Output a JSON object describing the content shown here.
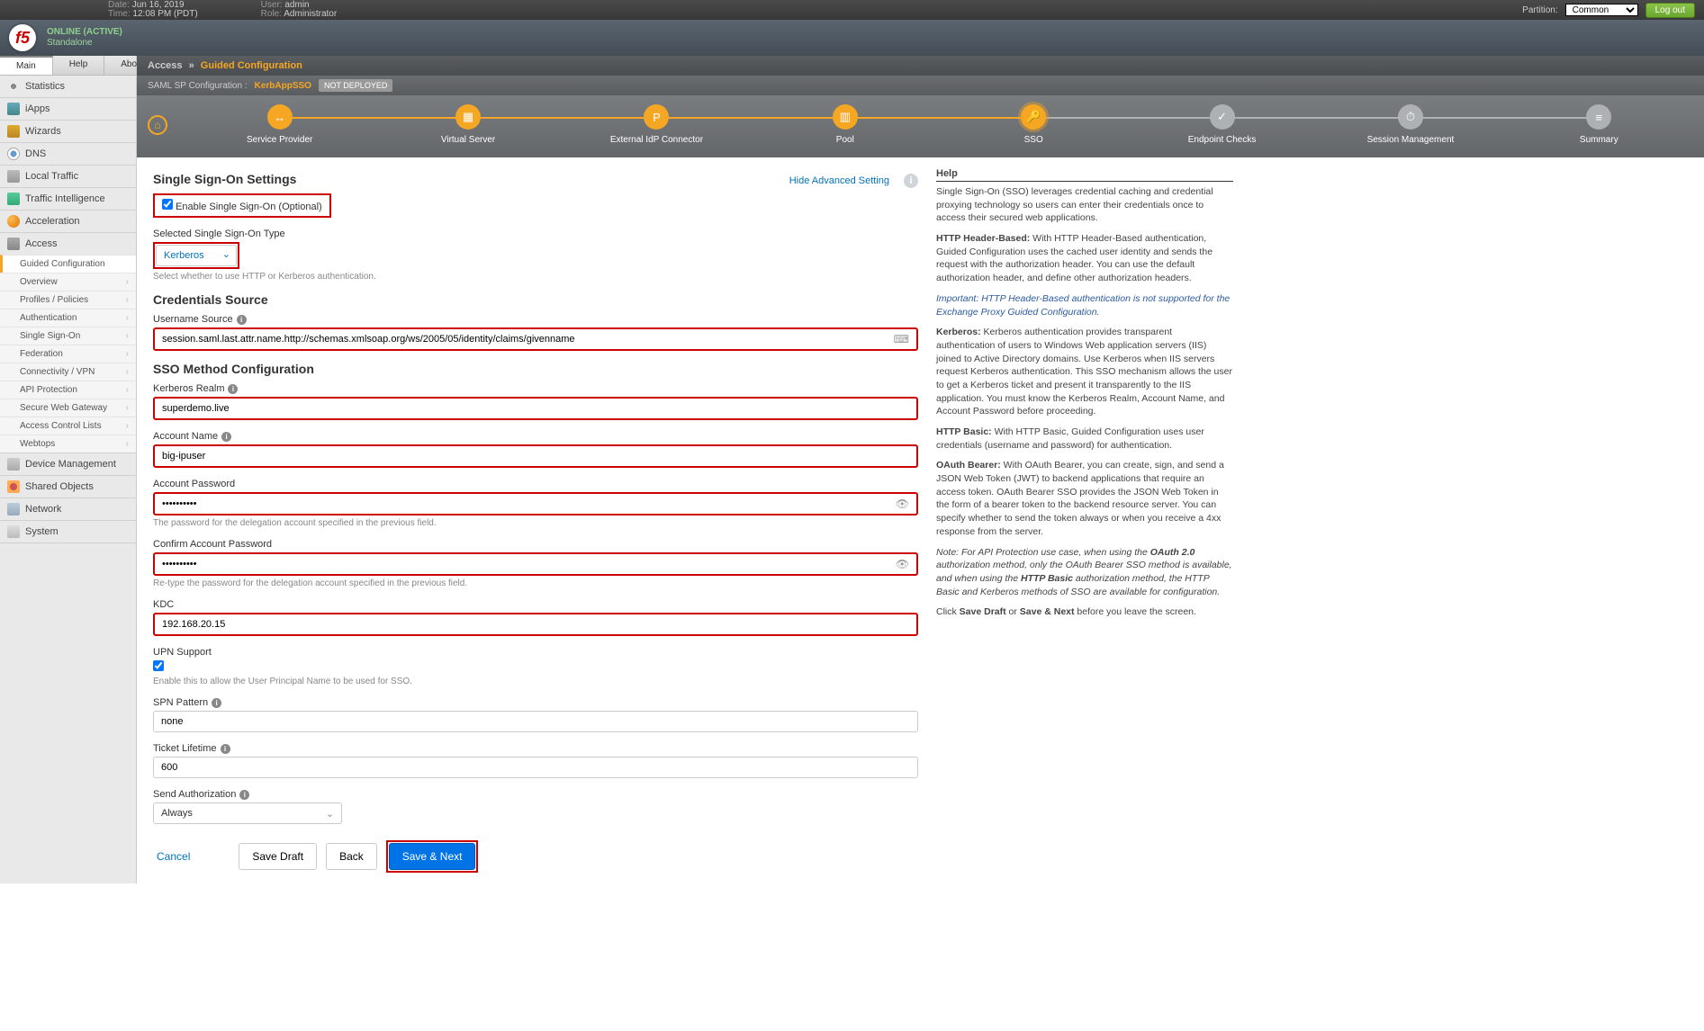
{
  "header": {
    "date_label": "Date:",
    "date_value": "Jun 16, 2019",
    "time_label": "Time:",
    "time_value": "12:08 PM (PDT)",
    "user_label": "User:",
    "user_value": "admin",
    "role_label": "Role:",
    "role_value": "Administrator",
    "partition_label": "Partition:",
    "partition_value": "Common",
    "logout": "Log out",
    "online_status": "ONLINE (ACTIVE)",
    "standalone": "Standalone"
  },
  "tabs": {
    "main": "Main",
    "help": "Help",
    "about": "About"
  },
  "nav": {
    "items": [
      {
        "label": "Statistics"
      },
      {
        "label": "iApps"
      },
      {
        "label": "Wizards"
      },
      {
        "label": "DNS"
      },
      {
        "label": "Local Traffic"
      },
      {
        "label": "Traffic Intelligence"
      },
      {
        "label": "Acceleration"
      },
      {
        "label": "Access"
      },
      {
        "label": "Device Management"
      },
      {
        "label": "Shared Objects"
      },
      {
        "label": "Network"
      },
      {
        "label": "System"
      }
    ],
    "access_sub": [
      {
        "label": "Guided Configuration",
        "active": true
      },
      {
        "label": "Overview"
      },
      {
        "label": "Profiles / Policies"
      },
      {
        "label": "Authentication"
      },
      {
        "label": "Single Sign-On"
      },
      {
        "label": "Federation"
      },
      {
        "label": "Connectivity / VPN"
      },
      {
        "label": "API Protection"
      },
      {
        "label": "Secure Web Gateway"
      },
      {
        "label": "Access Control Lists"
      },
      {
        "label": "Webtops"
      }
    ]
  },
  "breadcrumb": {
    "root": "Access",
    "sep": "»",
    "current": "Guided Configuration"
  },
  "subheader": {
    "prefix": "SAML SP Configuration :",
    "name": "KerbAppSSO",
    "badge": "NOT DEPLOYED"
  },
  "stepper": [
    {
      "label": "Service Provider",
      "icon": "↔",
      "state": "done"
    },
    {
      "label": "Virtual Server",
      "icon": "▦",
      "state": "done"
    },
    {
      "label": "External IdP Connector",
      "icon": "P",
      "state": "done"
    },
    {
      "label": "Pool",
      "icon": "▥",
      "state": "done"
    },
    {
      "label": "SSO",
      "icon": "🔑",
      "state": "current"
    },
    {
      "label": "Endpoint Checks",
      "icon": "✓",
      "state": "pending"
    },
    {
      "label": "Session Management",
      "icon": "⏱",
      "state": "pending"
    },
    {
      "label": "Summary",
      "icon": "≡",
      "state": "pending"
    }
  ],
  "form": {
    "title": "Single Sign-On Settings",
    "enable_label": "Enable Single Sign-On (Optional)",
    "enable_checked": true,
    "type_label": "Selected Single Sign-On Type",
    "type_value": "Kerberos",
    "type_hint": "Select whether to use HTTP or Kerberos authentication.",
    "advanced_link": "Hide Advanced Setting",
    "cred_title": "Credentials Source",
    "username_label": "Username Source",
    "username_value": "session.saml.last.attr.name.http://schemas.xmlsoap.org/ws/2005/05/identity/claims/givenname",
    "method_title": "SSO Method Configuration",
    "kerb_realm_label": "Kerberos Realm",
    "kerb_realm_value": "superdemo.live",
    "acct_name_label": "Account Name",
    "acct_name_value": "big-ipuser",
    "acct_pass_label": "Account Password",
    "acct_pass_value": "••••••••••",
    "acct_pass_hint": "The password for the delegation account specified in the previous field.",
    "confirm_pass_label": "Confirm Account Password",
    "confirm_pass_value": "••••••••••",
    "confirm_pass_hint": "Re-type the password for the delegation account specified in the previous field.",
    "kdc_label": "KDC",
    "kdc_value": "192.168.20.15",
    "upn_label": "UPN Support",
    "upn_checked": true,
    "upn_hint": "Enable this to allow the User Principal Name to be used for SSO.",
    "spn_label": "SPN Pattern",
    "spn_value": "none",
    "ticket_label": "Ticket Lifetime",
    "ticket_value": "600",
    "sendauth_label": "Send Authorization",
    "sendauth_value": "Always",
    "btn_cancel": "Cancel",
    "btn_draft": "Save Draft",
    "btn_back": "Back",
    "btn_next": "Save & Next"
  },
  "help": {
    "title": "Help",
    "p1": "Single Sign-On (SSO) leverages credential caching and credential proxying technology so users can enter their credentials once to access their secured web applications.",
    "p2a": "HTTP Header-Based:",
    "p2": " With HTTP Header-Based authentication, Guided Configuration uses the cached user identity and sends the request with the authorization header. You can use the default authorization header, and define other authorization headers.",
    "note1": "Important: HTTP Header-Based authentication is not supported for the Exchange Proxy Guided Configuration.",
    "p3a": "Kerberos:",
    "p3": " Kerberos authentication provides transparent authentication of users to Windows Web application servers (IIS) joined to Active Directory domains. Use Kerberos when IIS servers request Kerberos authentication. This SSO mechanism allows the user to get a Kerberos ticket and present it transparently to the IIS application. You must know the Kerberos Realm, Account Name, and Account Password before proceeding.",
    "p4a": "HTTP Basic:",
    "p4": " With HTTP Basic, Guided Configuration uses user credentials (username and password) for authentication.",
    "p5a": "OAuth Bearer:",
    "p5": " With OAuth Bearer, you can create, sign, and send a JSON Web Token (JWT) to backend applications that require an access token. OAuth Bearer SSO provides the JSON Web Token in the form of a bearer token to the backend resource server. You can specify whether to send the token always or when you receive a 4xx response from the server.",
    "note2a": "Note: For API Protection use case, when using the ",
    "note2b": "OAuth 2.0",
    "note2c": " authorization method, only the OAuth Bearer SSO method is available, and when using the ",
    "note2d": "HTTP Basic",
    "note2e": " authorization method, the HTTP Basic and Kerberos methods of SSO are available for configuration.",
    "p6a": "Click ",
    "p6b": "Save Draft",
    "p6c": " or ",
    "p6d": "Save & Next",
    "p6e": " before you leave the screen."
  }
}
